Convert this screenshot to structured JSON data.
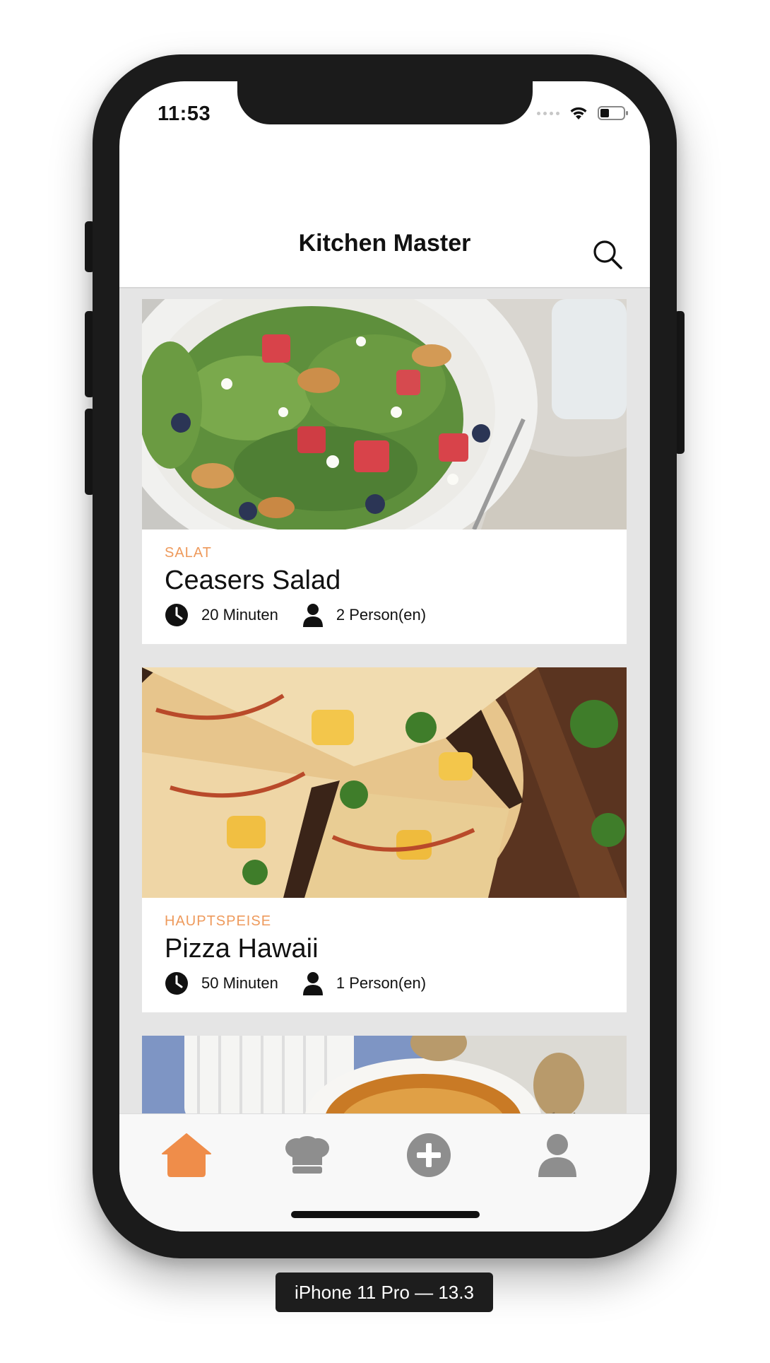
{
  "status_bar": {
    "time": "11:53"
  },
  "nav": {
    "title": "Kitchen Master",
    "search_icon": "search-icon"
  },
  "recipes": [
    {
      "category": "SALAT",
      "title": "Ceasers Salad",
      "time": "20 Minuten",
      "servings": "2 Person(en)",
      "image": "salad-photo"
    },
    {
      "category": "HAUPTSPEISE",
      "title": "Pizza Hawaii",
      "time": "50 Minuten",
      "servings": "1 Person(en)",
      "image": "pizza-photo"
    },
    {
      "category": "",
      "title": "",
      "time": "",
      "servings": "",
      "image": "creme-brulee-photo"
    }
  ],
  "tabbar": {
    "items": [
      {
        "icon": "home-icon",
        "active": true
      },
      {
        "icon": "chef-hat-icon",
        "active": false
      },
      {
        "icon": "add-circle-icon",
        "active": false
      },
      {
        "icon": "profile-icon",
        "active": false
      }
    ],
    "active_color": "#ef8d4a",
    "inactive_color": "#8e8e8e"
  },
  "device_label": "iPhone 11 Pro — 13.3",
  "colors": {
    "accent": "#ee9a5c",
    "feed_background": "#e5e5e5"
  }
}
